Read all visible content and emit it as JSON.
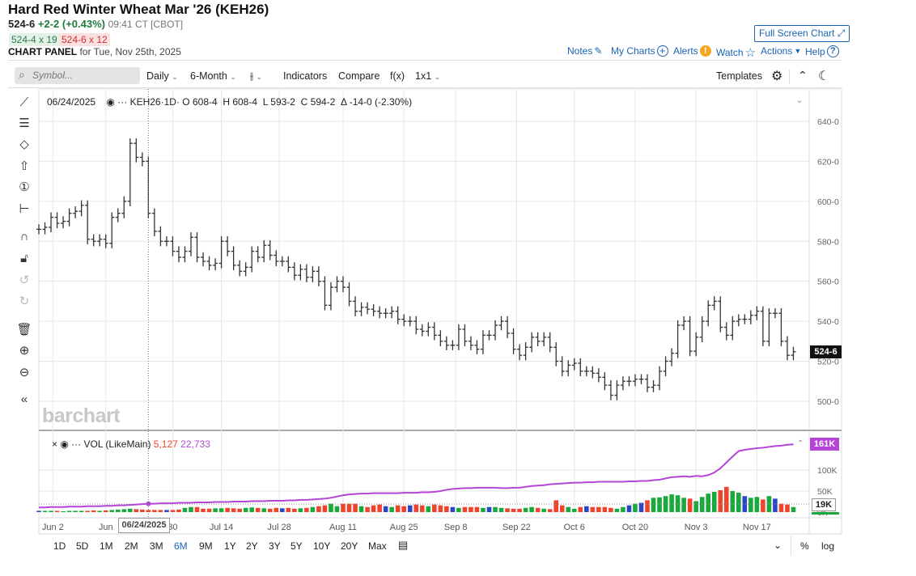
{
  "header": {
    "title": "Hard Red Winter Wheat Mar '26 (KEH26)",
    "last": "524-6",
    "change": "+2-2 (+0.43%)",
    "time": "09:41 CT [CBOT]",
    "bid": "524-4 x 19",
    "ask": "524-6 x 12",
    "panel_label": "CHART PANEL",
    "panel_date": "for Tue, Nov 25th, 2025"
  },
  "links": {
    "fullscreen": "Full Screen Chart",
    "notes": "Notes",
    "mycharts": "My Charts",
    "alerts": "Alerts",
    "watch": "Watch",
    "actions": "Actions",
    "help": "Help"
  },
  "toolbar": {
    "symbol_placeholder": "Symbol...",
    "interval": "Daily",
    "period": "6-Month",
    "indicators": "Indicators",
    "compare": "Compare",
    "fx": "f(x)",
    "layout": "1x1",
    "templates": "Templates"
  },
  "legend": {
    "date": "06/24/2025",
    "symbol": "KEH26",
    "interval": "·1D·",
    "open": "O 608-4",
    "high": "H 608-4",
    "low": "L 593-2",
    "close": "C 594-2",
    "delta": "Δ -14-0 (-2.30%)"
  },
  "volume_legend": {
    "name": "VOL (LikeMain)",
    "volume": "5,127",
    "oi": "22,733"
  },
  "watermark": "barchart",
  "crosshair_date": "06/24/2025",
  "last_price_label": "524-6",
  "vol_labels": {
    "oi_last": "161K",
    "vol_last": "19K"
  },
  "colors": {
    "up": "#19a83c",
    "down": "#f0432c",
    "unchanged": "#2b46c8",
    "oi": "#b445d6",
    "link": "#1a63b5"
  },
  "ranges": [
    "1D",
    "5D",
    "1M",
    "2M",
    "3M",
    "6M",
    "9M",
    "1Y",
    "2Y",
    "3Y",
    "5Y",
    "10Y",
    "20Y",
    "Max"
  ],
  "selected_range": "6M",
  "bottom_right": {
    "pct": "%",
    "log": "log"
  },
  "chart_data": {
    "type": "ohlc",
    "price_ticks": [
      {
        "v": 640,
        "label": "640-0"
      },
      {
        "v": 620,
        "label": "620-0"
      },
      {
        "v": 600,
        "label": "600-0"
      },
      {
        "v": 580,
        "label": "580-0"
      },
      {
        "v": 560,
        "label": "560-0"
      },
      {
        "v": 540,
        "label": "540-0"
      },
      {
        "v": 520,
        "label": "520-0"
      },
      {
        "v": 500,
        "label": "500-0"
      }
    ],
    "ylim": [
      486,
      652
    ],
    "close": [
      586,
      587,
      592,
      589,
      590,
      594,
      595,
      598,
      581,
      580,
      581,
      579,
      592,
      594,
      600,
      629,
      622,
      620,
      594,
      585,
      580,
      580,
      575,
      572,
      575,
      582,
      572,
      570,
      568,
      569,
      580,
      575,
      568,
      565,
      567,
      575,
      572,
      578,
      573,
      570,
      570,
      567,
      563,
      566,
      562,
      565,
      560,
      548,
      557,
      560,
      557,
      550,
      545,
      547,
      546,
      545,
      544,
      544,
      545,
      541,
      540,
      540,
      536,
      535,
      537,
      533,
      530,
      528,
      528,
      536,
      530,
      528,
      526,
      533,
      533,
      538,
      540,
      534,
      526,
      523,
      527,
      532,
      530,
      532,
      527,
      520,
      515,
      518,
      519,
      515,
      515,
      514,
      512,
      508,
      503,
      508,
      510,
      510,
      511,
      511,
      507,
      508,
      515,
      520,
      524,
      538,
      540,
      525,
      532,
      540,
      548,
      550,
      537,
      533,
      540,
      541,
      541,
      543,
      545,
      530,
      544,
      544,
      530,
      523,
      524.75
    ],
    "volume_k": [
      3,
      3,
      3,
      3,
      2,
      3,
      3,
      3,
      3,
      4,
      3,
      4,
      5,
      6,
      7,
      8,
      7,
      6,
      5,
      5,
      5,
      5,
      5,
      6,
      10,
      12,
      12,
      8,
      8,
      9,
      9,
      10,
      9,
      8,
      10,
      11,
      10,
      9,
      8,
      10,
      9,
      10,
      8,
      9,
      10,
      12,
      14,
      16,
      20,
      14,
      20,
      20,
      20,
      14,
      12,
      16,
      18,
      14,
      12,
      16,
      14,
      16,
      18,
      16,
      14,
      18,
      16,
      14,
      12,
      10,
      12,
      12,
      12,
      10,
      12,
      12,
      10,
      9,
      8,
      8,
      10,
      12,
      10,
      8,
      7,
      28,
      16,
      12,
      8,
      12,
      14,
      12,
      12,
      12,
      10,
      8,
      12,
      16,
      20,
      22,
      28,
      34,
      35,
      38,
      42,
      40,
      34,
      32,
      26,
      36,
      44,
      48,
      52,
      60,
      50,
      46,
      38,
      34,
      36,
      30,
      38,
      32,
      20,
      18,
      12
    ],
    "open_interest_k": [
      11,
      11,
      12,
      12,
      12,
      13,
      13,
      13,
      14,
      14,
      14,
      15,
      15,
      16,
      16,
      17,
      18,
      19,
      20,
      20,
      21,
      21,
      21,
      22,
      22,
      22,
      23,
      23,
      23,
      24,
      24,
      24,
      25,
      25,
      25,
      26,
      26,
      26,
      27,
      27,
      27,
      28,
      28,
      29,
      29,
      30,
      31,
      32,
      34,
      37,
      40,
      42,
      43,
      44,
      44,
      45,
      45,
      45,
      45,
      45,
      46,
      46,
      46,
      47,
      47,
      48,
      50,
      53,
      55,
      56,
      57,
      57,
      58,
      58,
      58,
      58,
      57,
      57,
      58,
      58,
      60,
      62,
      63,
      64,
      66,
      67,
      68,
      69,
      70,
      70,
      71,
      71,
      72,
      72,
      72,
      72,
      72,
      73,
      73,
      74,
      74,
      76,
      77,
      80,
      83,
      84,
      85,
      84,
      86,
      85,
      88,
      94,
      104,
      118,
      132,
      145,
      148,
      150,
      152,
      153,
      155,
      157,
      158,
      160,
      161
    ],
    "vol_ticks": [
      {
        "v": 100,
        "label": "100K"
      },
      {
        "v": 50,
        "label": "50K"
      },
      {
        "v": 0,
        "label": "0K"
      }
    ],
    "vol_ylim": [
      0,
      175
    ],
    "x_ticks": [
      {
        "i": 2.3,
        "label": "Jun 2"
      },
      {
        "i": 11,
        "label": "Jun"
      },
      {
        "i": 22,
        "label": "30"
      },
      {
        "i": 30,
        "label": "Jul 14"
      },
      {
        "i": 39.5,
        "label": "Jul 28"
      },
      {
        "i": 50,
        "label": "Aug 11"
      },
      {
        "i": 60,
        "label": "Aug 25"
      },
      {
        "i": 68.5,
        "label": "Sep 8"
      },
      {
        "i": 78.5,
        "label": "Sep 22"
      },
      {
        "i": 88,
        "label": "Oct 6"
      },
      {
        "i": 98,
        "label": "Oct 20"
      },
      {
        "i": 108,
        "label": "Nov 3"
      },
      {
        "i": 118,
        "label": "Nov 17"
      }
    ],
    "hover_index": 18
  }
}
